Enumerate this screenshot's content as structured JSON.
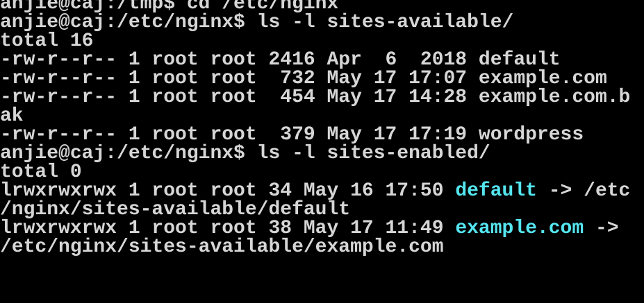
{
  "terminal": {
    "colors": {
      "background": "#000000",
      "foreground": "#d6d6d6",
      "symlink": "#55e6f0"
    },
    "lines": [
      "anjie@caj:/tmp$ cd /etc/nginx",
      "anjie@caj:/etc/nginx$ ls -l sites-available/",
      "total 16",
      "-rw-r--r-- 1 root root 2416 Apr  6  2018 default",
      "-rw-r--r-- 1 root root  732 May 17 17:07 example.com",
      "-rw-r--r-- 1 root root  454 May 17 14:28 example.com.b",
      "ak",
      "-rw-r--r-- 1 root root  379 May 17 17:19 wordpress",
      "anjie@caj:/etc/nginx$ ls -l sites-enabled/",
      "total 0"
    ],
    "link1": {
      "prefix": "lrwxrwxrwx 1 root root 34 May 16 17:50 ",
      "name": "default",
      "arrow": " -> /etc",
      "wrap": "/nginx/sites-available/default"
    },
    "link2": {
      "prefix": "lrwxrwxrwx 1 root root 38 May 17 11:49 ",
      "name": "example.com",
      "arrow": " ->",
      "wrap": "/etc/nginx/sites-available/example.com"
    }
  }
}
